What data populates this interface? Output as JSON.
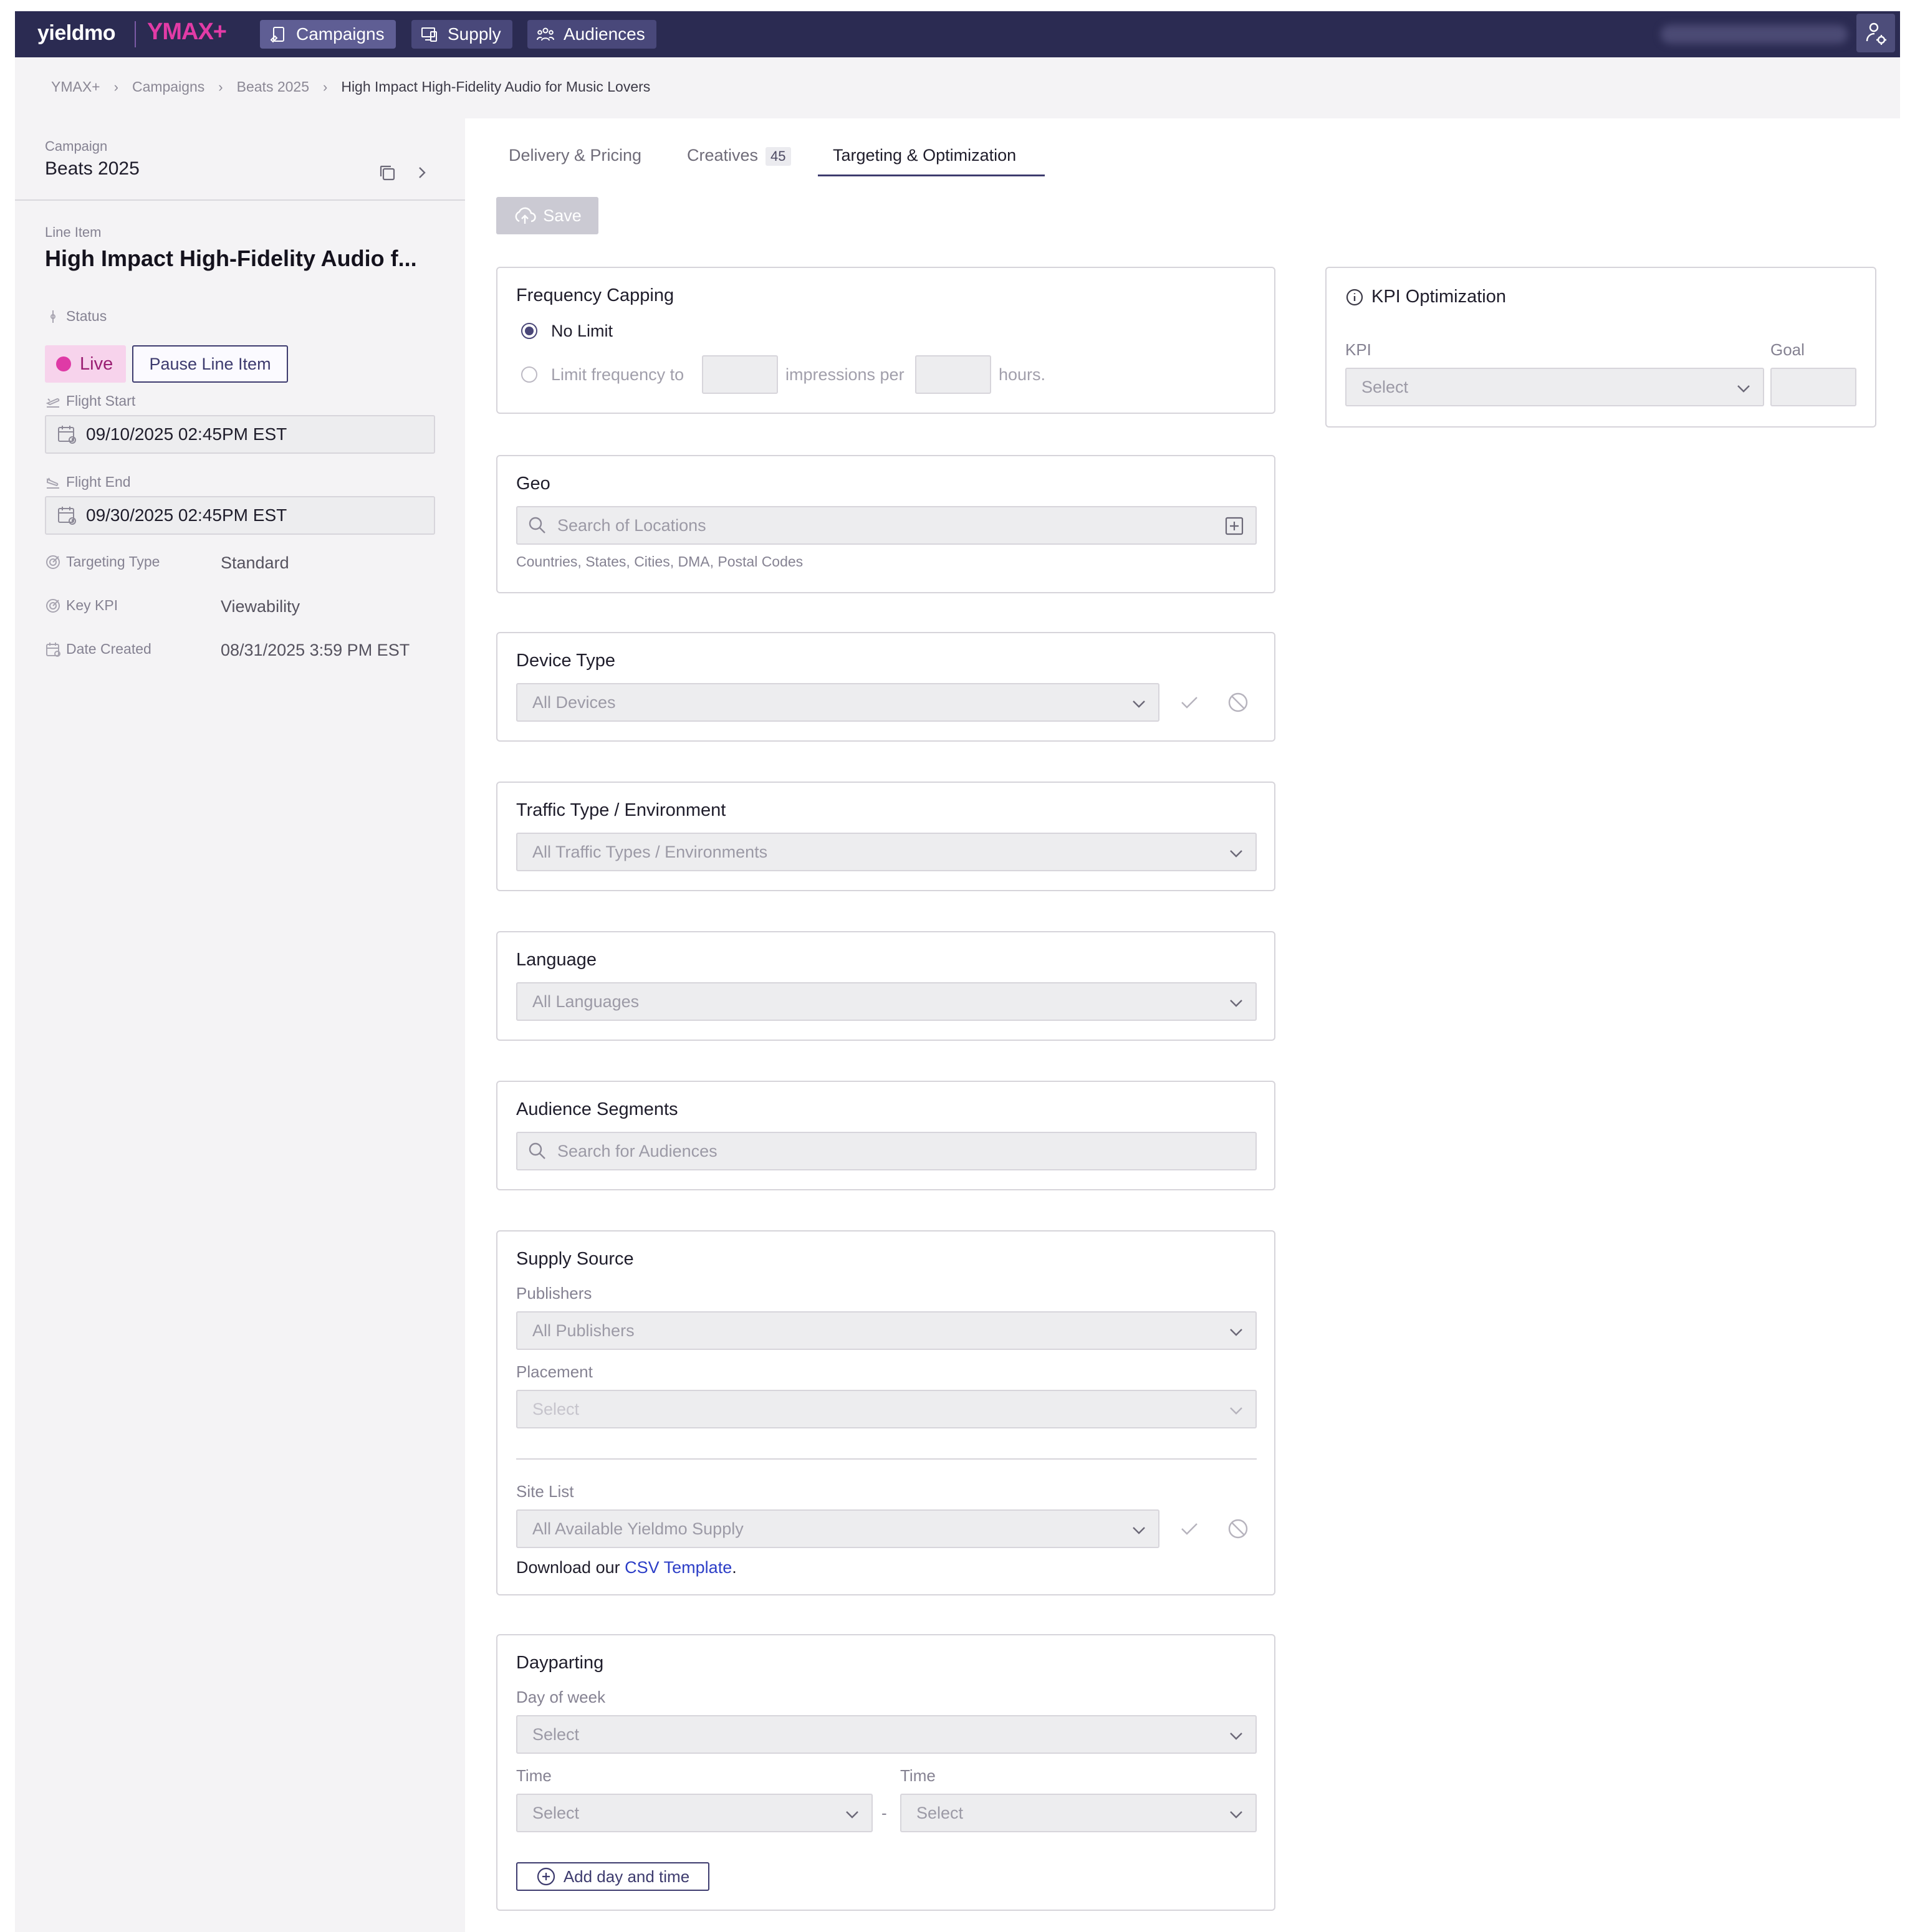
{
  "nav": {
    "logo": "yieldmo",
    "product": "YMAX+",
    "items": [
      {
        "label": "Campaigns",
        "icon": "campaign-icon",
        "active": true
      },
      {
        "label": "Supply",
        "icon": "devices-icon",
        "active": false
      },
      {
        "label": "Audiences",
        "icon": "audience-icon",
        "active": false
      }
    ],
    "user_icon": "user-settings-icon"
  },
  "breadcrumb": [
    "YMAX+",
    "Campaigns",
    "Beats 2025",
    "High Impact High-Fidelity Audio for Music Lovers"
  ],
  "campaign": {
    "label": "Campaign",
    "name": "Beats 2025"
  },
  "line_item": {
    "label": "Line Item",
    "name": "High Impact High-Fidelity Audio f...",
    "status_label": "Status",
    "status": "Live",
    "pause_label": "Pause Line Item",
    "flight_start_label": "Flight Start",
    "flight_start": "09/10/2025 02:45PM EST",
    "flight_end_label": "Flight End",
    "flight_end": "09/30/2025 02:45PM EST",
    "targeting_type_label": "Targeting Type",
    "targeting_type": "Standard",
    "key_kpi_label": "Key KPI",
    "key_kpi": "Viewability",
    "date_created_label": "Date Created",
    "date_created": "08/31/2025 3:59 PM EST"
  },
  "tabs": [
    {
      "label": "Delivery & Pricing"
    },
    {
      "label": "Creatives",
      "badge": "45"
    },
    {
      "label": "Targeting & Optimization",
      "active": true
    }
  ],
  "save_label": "Save",
  "frequency": {
    "title": "Frequency Capping",
    "no_limit": "No Limit",
    "limit_to": "Limit frequency to",
    "impressions_per": "impressions per",
    "hours": "hours."
  },
  "geo": {
    "title": "Geo",
    "placeholder": "Search of Locations",
    "hint": "Countries, States, Cities, DMA, Postal Codes"
  },
  "device": {
    "title": "Device Type",
    "value": "All Devices"
  },
  "traffic": {
    "title": "Traffic Type / Environment",
    "value": "All Traffic Types / Environments"
  },
  "language": {
    "title": "Language",
    "value": "All Languages"
  },
  "audience": {
    "title": "Audience Segments",
    "placeholder": "Search for Audiences"
  },
  "supply": {
    "title": "Supply Source",
    "publishers_label": "Publishers",
    "publishers_value": "All Publishers",
    "placement_label": "Placement",
    "placement_value": "Select",
    "site_list_label": "Site List",
    "site_list_value": "All Available Yieldmo Supply",
    "download_prefix": "Download our",
    "download_link": "CSV Template",
    "download_suffix": "."
  },
  "dayparting": {
    "title": "Dayparting",
    "day_label": "Day of week",
    "day_value": "Select",
    "time_label_1": "Time",
    "time_value_1": "Select",
    "time_sep": "-",
    "time_label_2": "Time",
    "time_value_2": "Select",
    "add_label": "Add day and time"
  },
  "kpi": {
    "title": "KPI Optimization",
    "kpi_label": "KPI",
    "kpi_value": "Select",
    "goal_label": "Goal"
  },
  "colors": {
    "nav": "#2b2b52",
    "accent": "#e23ba6",
    "primary": "#3d3b6e",
    "link": "#2c3ec7"
  }
}
